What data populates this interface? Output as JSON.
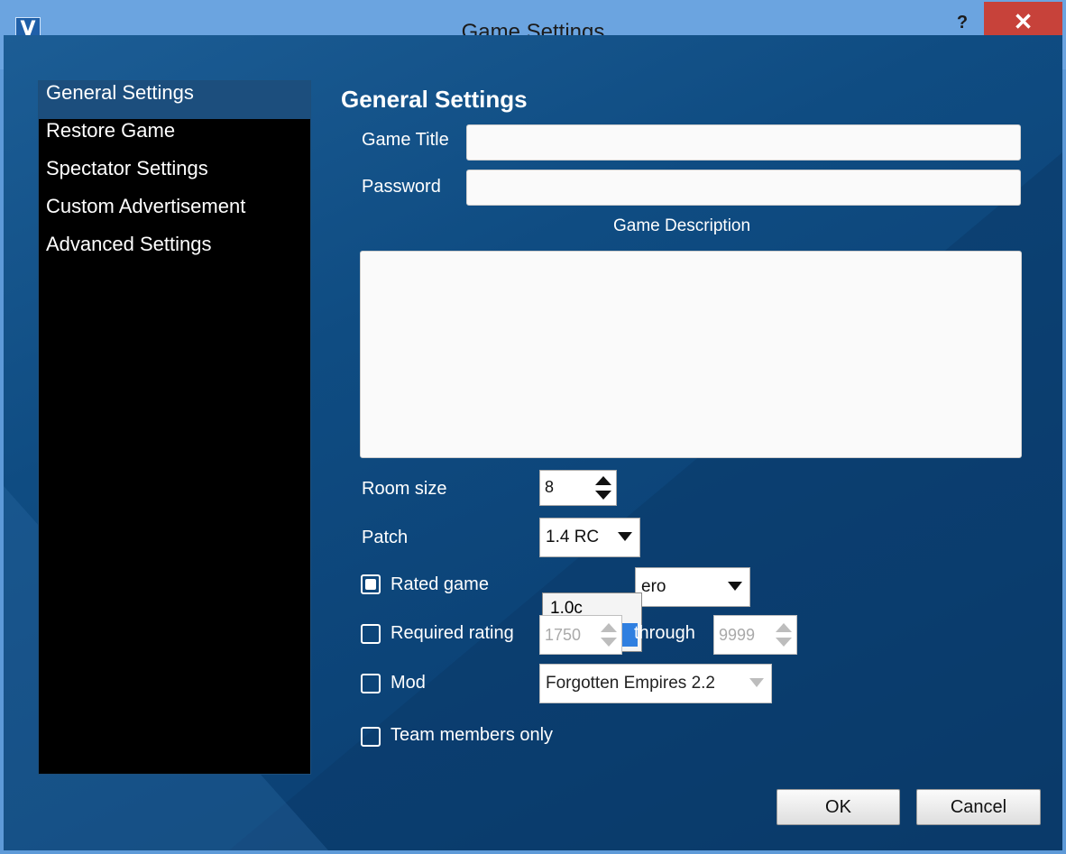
{
  "window": {
    "title": "Game Settings",
    "icon_letter": "V",
    "help_label": "?",
    "close_label": "✕"
  },
  "nav": {
    "items": [
      {
        "label": "General Settings"
      },
      {
        "label": "Restore Game"
      },
      {
        "label": "Spectator Settings"
      },
      {
        "label": "Custom Advertisement"
      },
      {
        "label": "Advanced Settings"
      }
    ]
  },
  "general": {
    "section_title": "General Settings",
    "game_title_label": "Game Title",
    "game_title_value": "",
    "password_label": "Password",
    "password_value": "",
    "description_label": "Game Description",
    "description_value": "",
    "room_size_label": "Room size",
    "room_size_value": "8",
    "patch_label": "Patch",
    "patch_value": "1.4 RC",
    "patch_options": [
      "1.0c",
      "1.4 RC"
    ],
    "rated_label": "Rated game",
    "rated_checked": true,
    "rated_combo_partial": "ero",
    "required_rating_label": "Required rating",
    "required_rating_checked": false,
    "rating_min": "1750",
    "through_label": "through",
    "rating_max": "9999",
    "mod_label": "Mod",
    "mod_checked": false,
    "mod_value": "Forgotten Empires 2.2",
    "team_only_label": "Team members only",
    "team_only_checked": false
  },
  "buttons": {
    "ok": "OK",
    "cancel": "Cancel"
  },
  "colors": {
    "titlebar": "#6ba4e0",
    "close": "#c7423a",
    "panel": "#0f4c82",
    "selection": "#2f7fe0"
  }
}
